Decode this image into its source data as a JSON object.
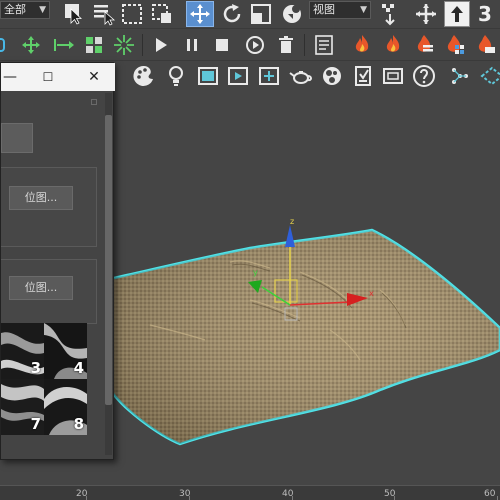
{
  "toolbar_main": {
    "selection_filter": "全部",
    "reference_coord": "视图",
    "snap_label": "3"
  },
  "dialog": {
    "minimize_glyph": "—",
    "maximize_glyph": "☐",
    "close_glyph": "✕",
    "bitmap_button_1": "位图...",
    "bitmap_button_2": "位图...",
    "thumbnails": [
      "3",
      "4",
      "7",
      "8"
    ]
  },
  "viewport": {
    "axis_x_label": "x",
    "axis_y_label": "y",
    "axis_z_label": "z",
    "selection_color": "#4fe3e8",
    "cloth_color": "#9f8b64"
  },
  "timeline": {
    "ticks": [
      "20",
      "30",
      "40",
      "50",
      "60"
    ]
  }
}
